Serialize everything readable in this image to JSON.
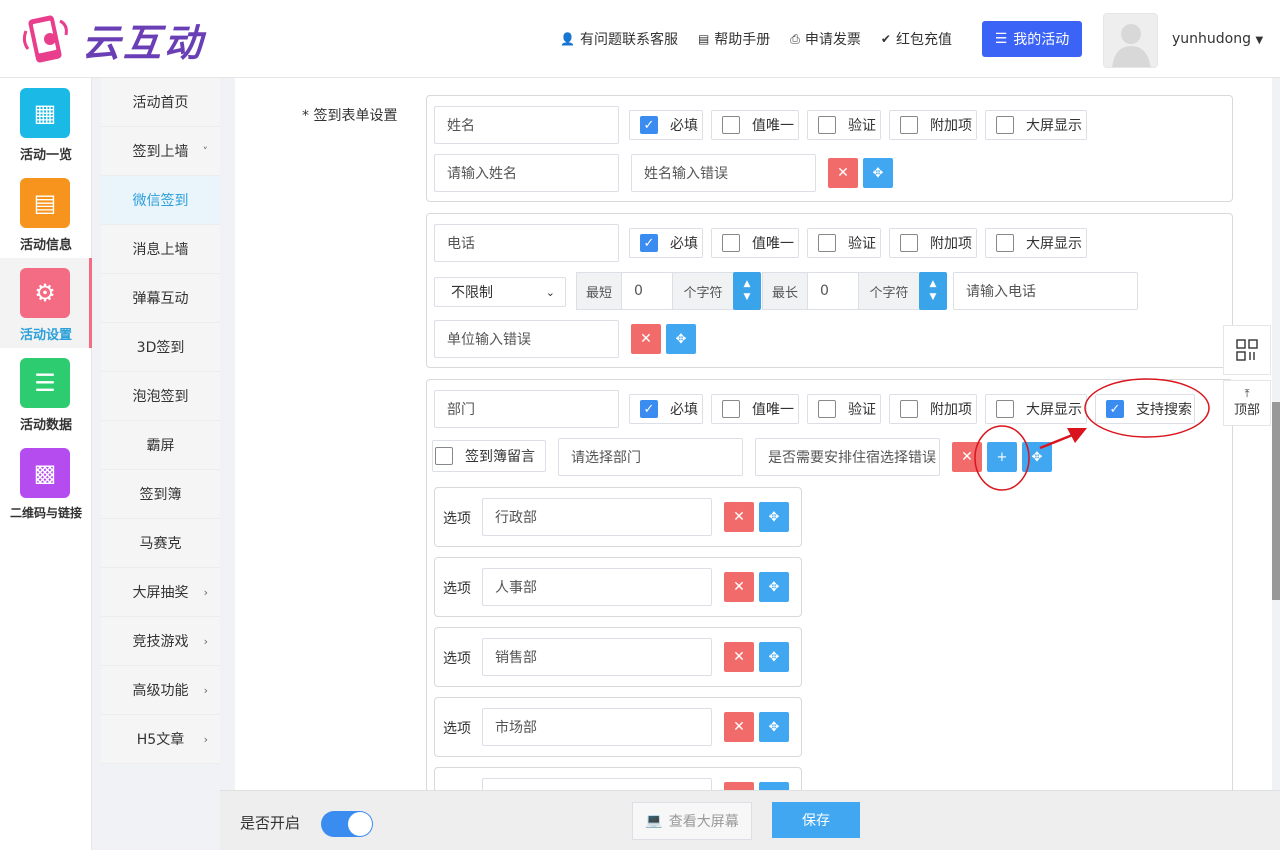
{
  "header": {
    "logo_text": "云互动",
    "nav": [
      {
        "label": "有问题联系客服",
        "icon": "user-plus-icon"
      },
      {
        "label": "帮助手册",
        "icon": "book-icon"
      },
      {
        "label": "申请发票",
        "icon": "printer-icon"
      },
      {
        "label": "红包充值",
        "icon": "shield-check-icon"
      }
    ],
    "my_activity": "我的活动",
    "username": "yunhudong"
  },
  "leftbar": [
    {
      "label": "活动一览",
      "color": "#1bb9e6",
      "icon": "grid-icon"
    },
    {
      "label": "活动信息",
      "color": "#f7941d",
      "icon": "document-icon"
    },
    {
      "label": "活动设置",
      "color": "#f46b84",
      "icon": "gear-icon"
    },
    {
      "label": "活动数据",
      "color": "#2ecc71",
      "icon": "database-icon"
    },
    {
      "label": "二维码与链接",
      "color": "#b44cf0",
      "icon": "qrcode-icon"
    }
  ],
  "subnav": [
    {
      "label": "活动首页",
      "chev": ""
    },
    {
      "label": "签到上墙",
      "chev": "˅"
    },
    {
      "label": "微信签到",
      "chev": ""
    },
    {
      "label": "消息上墙",
      "chev": ""
    },
    {
      "label": "弹幕互动",
      "chev": ""
    },
    {
      "label": "3D签到",
      "chev": ""
    },
    {
      "label": "泡泡签到",
      "chev": ""
    },
    {
      "label": "霸屏",
      "chev": ""
    },
    {
      "label": "签到簿",
      "chev": ""
    },
    {
      "label": "马赛克",
      "chev": ""
    },
    {
      "label": "大屏抽奖",
      "chev": "›"
    },
    {
      "label": "竞技游戏",
      "chev": "›"
    },
    {
      "label": "高级功能",
      "chev": "›"
    },
    {
      "label": "H5文章",
      "chev": "›"
    }
  ],
  "form": {
    "label": "* 签到表单设置",
    "checkbox_labels": {
      "required": "必填",
      "unique": "值唯一",
      "verify": "验证",
      "extra": "附加项",
      "bigscreen": "大屏显示",
      "search": "支持搜索",
      "guestbook": "签到簿留言"
    },
    "field1": {
      "name": "姓名",
      "placeholder": "请输入姓名",
      "error": "姓名输入错误",
      "required": true
    },
    "field2": {
      "name": "电话",
      "limit": "不限制",
      "min_label": "最短",
      "min": "0",
      "unit": "个字符",
      "max_label": "最长",
      "max": "0",
      "placeholder": "请输入电话",
      "error": "单位输入错误",
      "required": true
    },
    "field3": {
      "name": "部门",
      "placeholder": "请选择部门",
      "error": "是否需要安排住宿选择错误",
      "required": true,
      "search": true,
      "guestbook": false,
      "option_label": "选项",
      "options": [
        "行政部",
        "人事部",
        "销售部",
        "市场部"
      ]
    }
  },
  "float": {
    "top_label": "顶部"
  },
  "bottom": {
    "enabled_label": "是否开启",
    "enabled": true,
    "view_label": "查看大屏幕",
    "save_label": "保存"
  }
}
